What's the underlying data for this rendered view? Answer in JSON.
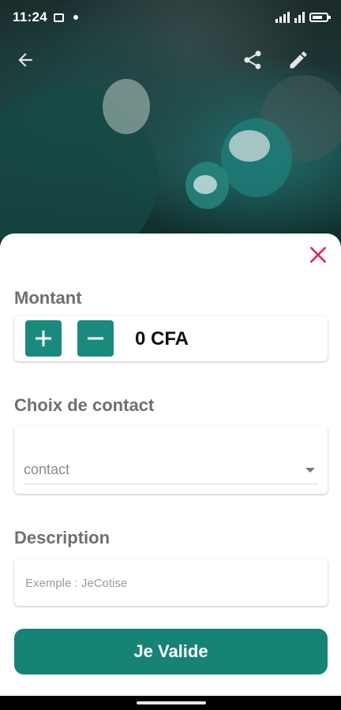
{
  "status_bar": {
    "time": "11:24",
    "notification_icons": [
      "message-icon",
      "dot-icon"
    ],
    "right_icons": [
      "signal-icon",
      "battery-icon"
    ]
  },
  "app_bar": {
    "back_icon": "arrow-left-icon",
    "share_icon": "share-icon",
    "edit_icon": "pencil-icon"
  },
  "sheet": {
    "close_icon": "close-icon",
    "amount": {
      "label": "Montant",
      "value": "0 CFA",
      "increment_icon": "plus-icon",
      "decrement_icon": "minus-icon"
    },
    "contact": {
      "label": "Choix de contact",
      "placeholder": "contact"
    },
    "description": {
      "label": "Description",
      "placeholder": "Exemple : JeCotise",
      "value": ""
    },
    "submit_label": "Je Valide"
  },
  "colors": {
    "accent": "#168376",
    "step_button": "#1a8a7e",
    "close": "#e0245e",
    "label_gray": "#6f6f6f"
  }
}
